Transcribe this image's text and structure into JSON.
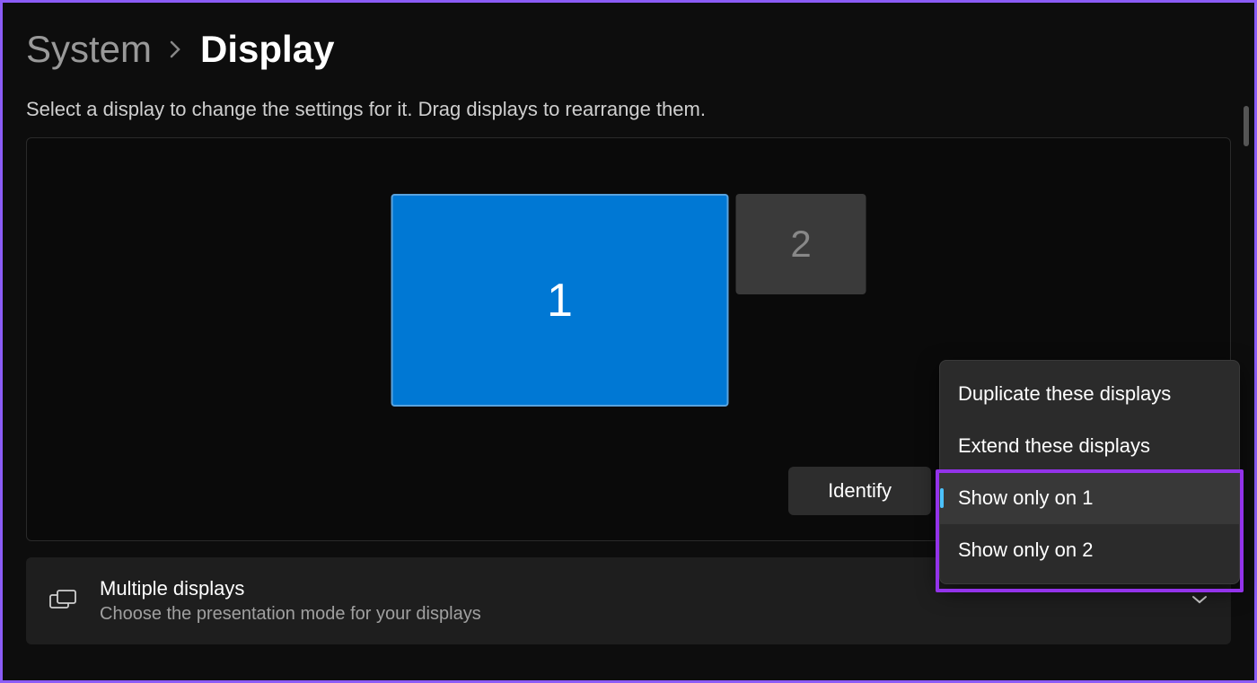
{
  "breadcrumb": {
    "parent": "System",
    "current": "Display"
  },
  "instruction": "Select a display to change the settings for it. Drag displays to rearrange them.",
  "monitors": {
    "primary_label": "1",
    "secondary_label": "2"
  },
  "identify_label": "Identify",
  "dropdown": {
    "items": [
      "Duplicate these displays",
      "Extend these displays",
      "Show only on 1",
      "Show only on 2"
    ],
    "selected_index": 2
  },
  "multiple_displays": {
    "title": "Multiple displays",
    "subtitle": "Choose the presentation mode for your displays"
  }
}
